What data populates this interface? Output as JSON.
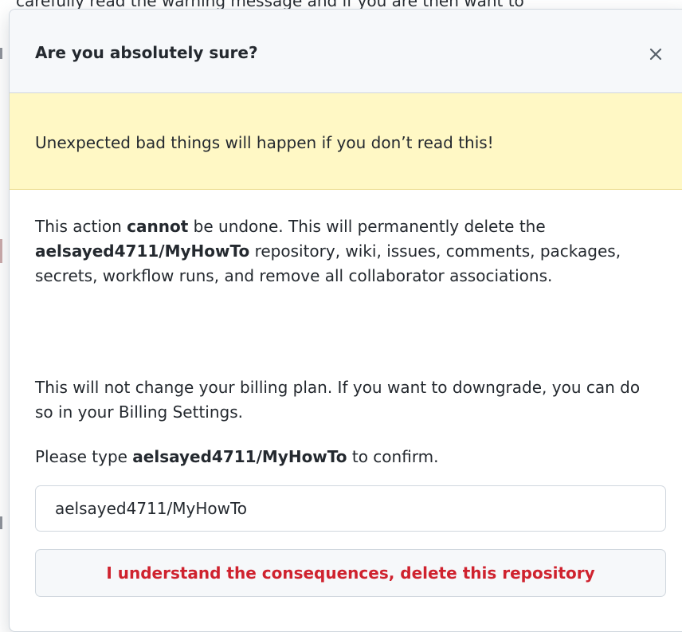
{
  "background": {
    "partial_text": "carefully read the warning message and if you are then want to"
  },
  "dialog": {
    "title": "Are you absolutely sure?",
    "close_icon": "close-icon",
    "warning": "Unexpected bad things will happen if you don’t read this!",
    "paragraph1": {
      "part1": "This action ",
      "strong1": "cannot",
      "part2": " be undone. This will permanently delete the ",
      "strong2": "aelsayed4711/MyHowTo",
      "part3": " repository, wiki, issues, comments, packages, secrets, workflow runs, and remove all collaborator associations."
    },
    "paragraph2": "This will not change your billing plan. If you want to downgrade, you can do so in your Billing Settings.",
    "paragraph3": {
      "part1": "Please type ",
      "strong": "aelsayed4711/MyHowTo",
      "part2": " to confirm."
    },
    "input_value": "aelsayed4711/MyHowTo",
    "delete_button": "I understand the consequences, delete this repository"
  },
  "colors": {
    "danger": "#cf222e",
    "warning_bg": "#fff8c5",
    "header_bg": "#f6f8fa",
    "border": "#d0d7de"
  }
}
